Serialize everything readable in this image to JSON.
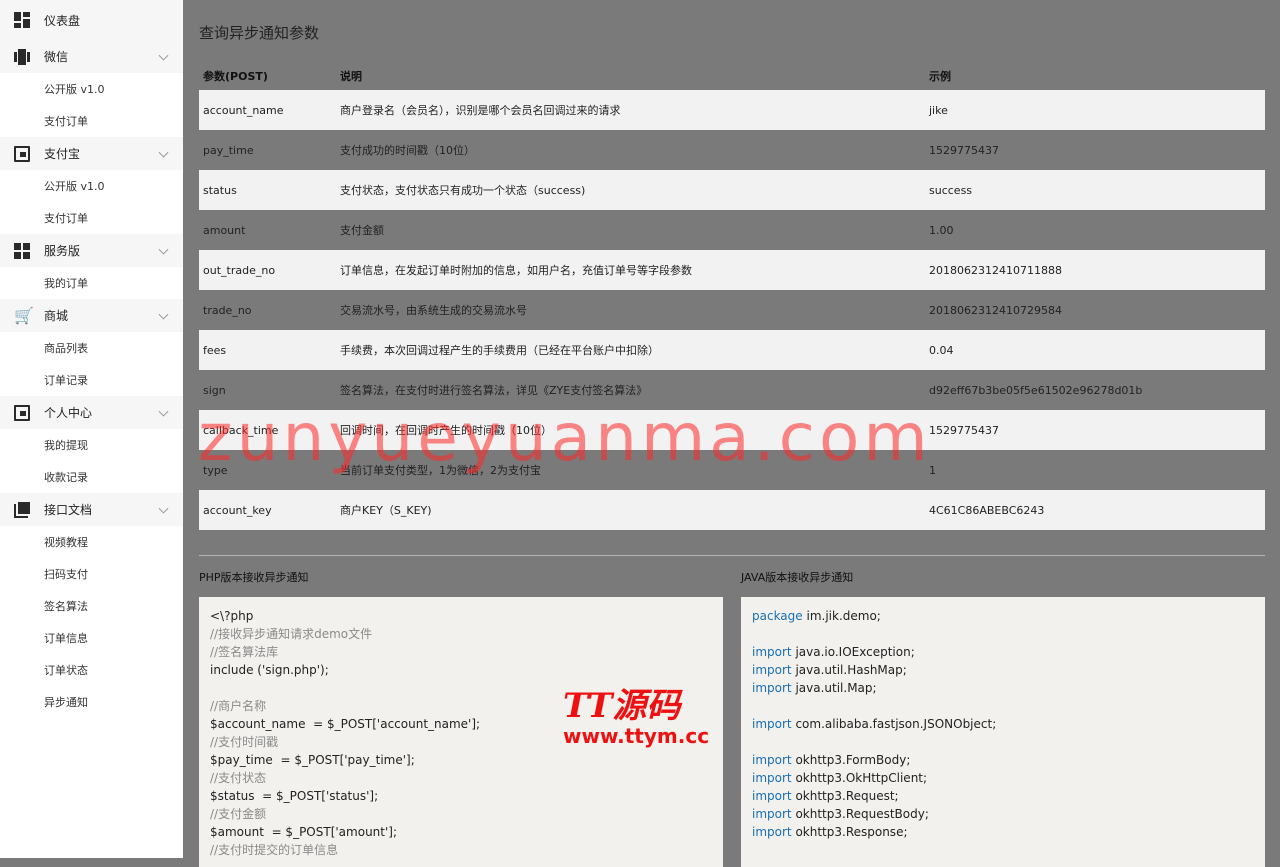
{
  "sidebar": {
    "dashboard": "仪表盘",
    "wechat": {
      "label": "微信",
      "items": [
        "公开版 v1.0",
        "支付订单"
      ]
    },
    "alipay": {
      "label": "支付宝",
      "items": [
        "公开版 v1.0",
        "支付订单"
      ]
    },
    "service": {
      "label": "服务版",
      "items": [
        "我的订单"
      ]
    },
    "mall": {
      "label": "商城",
      "items": [
        "商品列表",
        "订单记录"
      ]
    },
    "personal": {
      "label": "个人中心",
      "items": [
        "我的提现",
        "收款记录"
      ]
    },
    "api": {
      "label": "接口文档",
      "items": [
        "视频教程",
        "扫码支付",
        "签名算法",
        "订单信息",
        "订单状态",
        "异步通知"
      ]
    }
  },
  "main": {
    "title": "查询异步通知参数",
    "table": {
      "headers": [
        "参数(POST)",
        "说明",
        "示例"
      ],
      "rows": [
        [
          "account_name",
          "商户登录名（会员名），识别是哪个会员名回调过来的请求",
          "jike"
        ],
        [
          "pay_time",
          "支付成功的时间戳（10位）",
          "1529775437"
        ],
        [
          "status",
          "支付状态，支付状态只有成功一个状态（success)",
          "success"
        ],
        [
          "amount",
          "支付金额",
          "1.00"
        ],
        [
          "out_trade_no",
          "订单信息，在发起订单时附加的信息，如用户名，充值订单号等字段参数",
          "2018062312410711888"
        ],
        [
          "trade_no",
          "交易流水号，由系统生成的交易流水号",
          "2018062312410729584"
        ],
        [
          "fees",
          "手续费，本次回调过程产生的手续费用（已经在平台账户中扣除）",
          "0.04"
        ],
        [
          "sign",
          "签名算法，在支付时进行签名算法，详见《ZYE支付签名算法》",
          "d92eff67b3be05f5e61502e96278d01b"
        ],
        [
          "callback_time",
          "回调时间，在回调时产生的时间戳（10位）",
          "1529775437"
        ],
        [
          "type",
          "当前订单支付类型，1为微信，2为支付宝",
          "1"
        ],
        [
          "account_key",
          "商户KEY（S_KEY)",
          "4C61C86ABEBC6243"
        ]
      ]
    },
    "php_title": "PHP版本接收异步通知",
    "java_title": "JAVA版本接收异步通知",
    "php_code": [
      {
        "c": "",
        "t": "<\\?php"
      },
      {
        "c": "cm",
        "t": "//接收异步通知请求demo文件"
      },
      {
        "c": "cm",
        "t": "//签名算法库"
      },
      {
        "c": "",
        "t": "include ('sign.php');"
      },
      {
        "c": "",
        "t": ""
      },
      {
        "c": "cm",
        "t": "//商户名称"
      },
      {
        "c": "",
        "t": "$account_name  = $_POST['account_name'];"
      },
      {
        "c": "cm",
        "t": "//支付时间戳"
      },
      {
        "c": "",
        "t": "$pay_time  = $_POST['pay_time'];"
      },
      {
        "c": "cm",
        "t": "//支付状态"
      },
      {
        "c": "",
        "t": "$status  = $_POST['status'];"
      },
      {
        "c": "cm",
        "t": "//支付金额"
      },
      {
        "c": "",
        "t": "$amount  = $_POST['amount'];"
      },
      {
        "c": "cm",
        "t": "//支付时提交的订单信息"
      }
    ],
    "java_code": [
      {
        "k": "package",
        "t": " im.jik.demo;"
      },
      {
        "k": "",
        "t": ""
      },
      {
        "k": "import",
        "t": " java.io.IOException;"
      },
      {
        "k": "import",
        "t": " java.util.HashMap;"
      },
      {
        "k": "import",
        "t": " java.util.Map;"
      },
      {
        "k": "",
        "t": ""
      },
      {
        "k": "import",
        "t": " com.alibaba.fastjson.JSONObject;"
      },
      {
        "k": "",
        "t": ""
      },
      {
        "k": "import",
        "t": " okhttp3.FormBody;"
      },
      {
        "k": "import",
        "t": " okhttp3.OkHttpClient;"
      },
      {
        "k": "import",
        "t": " okhttp3.Request;"
      },
      {
        "k": "import",
        "t": " okhttp3.RequestBody;"
      },
      {
        "k": "import",
        "t": " okhttp3.Response;"
      }
    ]
  },
  "watermark": "zunyueyuanma.com",
  "logo": {
    "line1": "TT源码",
    "line2": "www.ttym.cc"
  }
}
